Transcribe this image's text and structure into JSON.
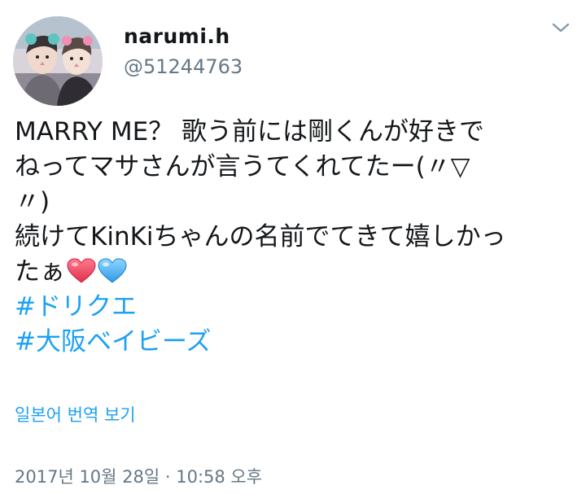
{
  "author": {
    "display_name": "narumi.h",
    "handle": "@51244763"
  },
  "tweet": {
    "lines": [
      "MARRY ME？ 歌う前には剛くんが好きで",
      "ねってマサさんが言うてくれてたー(〃▽",
      "〃)",
      "続けてKinKiちゃんの名前でてきて嬉しかっ",
      "たぁ"
    ],
    "emoji": [
      "red-heart",
      "blue-heart"
    ],
    "hashtags": [
      "#ドリクエ",
      "#大阪ベイビーズ"
    ]
  },
  "translate_label": "일본어 번역 보기",
  "timestamp": "2017년 10월 28일 · 10:58 오후",
  "colors": {
    "link": "#1da1f2",
    "secondary": "#657786",
    "text": "#14171a"
  }
}
